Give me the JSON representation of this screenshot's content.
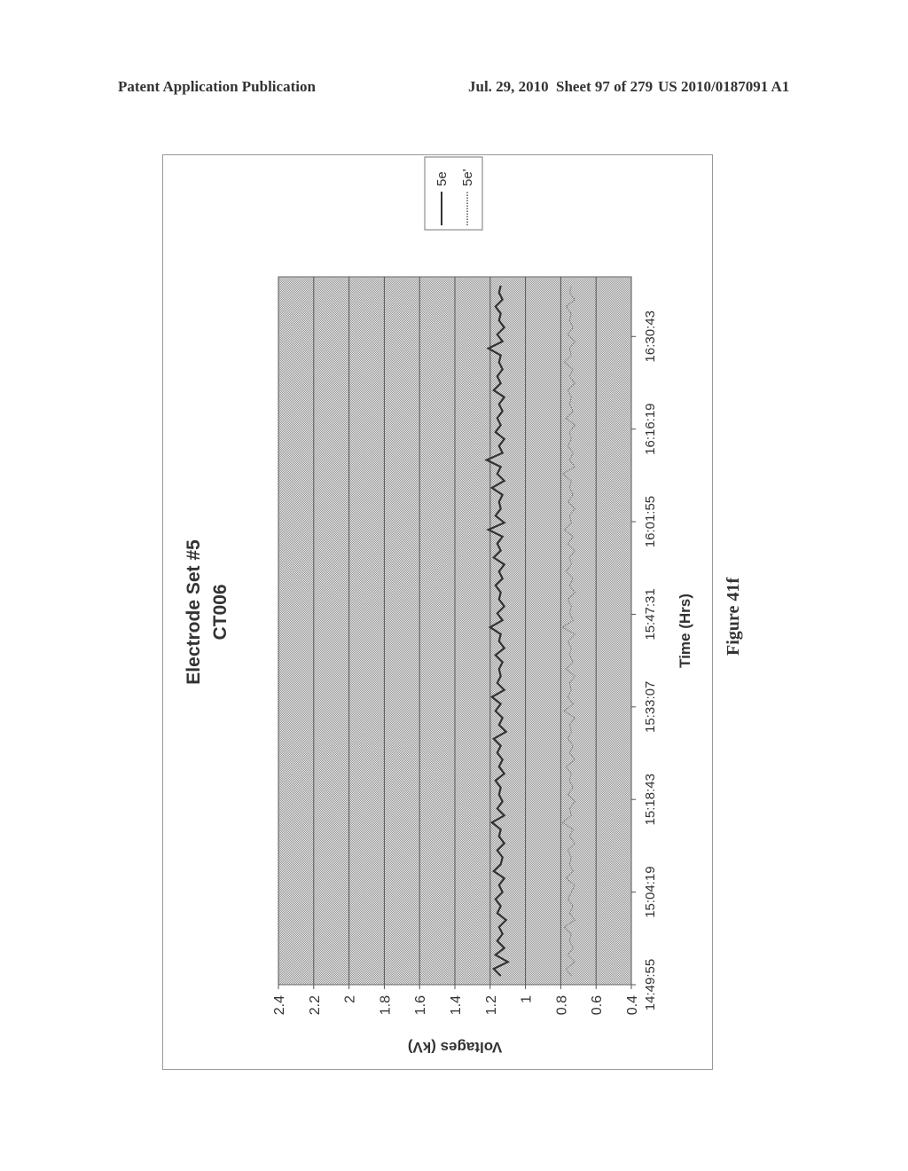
{
  "header": {
    "left": "Patent Application Publication",
    "date": "Jul. 29, 2010",
    "sheet": "Sheet 97 of 279",
    "number": "US 2010/0187091 A1"
  },
  "figure_label": "Figure 41f",
  "chart_data": {
    "type": "line",
    "title": "Electrode Set #5",
    "subtitle": "CT006",
    "xlabel": "Time (Hrs)",
    "ylabel": "Voltages (kV)",
    "orientation": "rotated-90-ccw",
    "ylim": [
      0.4,
      2.4
    ],
    "y_ticks": [
      "2.4",
      "2.2",
      "2",
      "1.8",
      "1.6",
      "1.4",
      "1.2",
      "1",
      "0.8",
      "0.6",
      "0.4"
    ],
    "x_ticks": [
      "14:49:55",
      "15:04:19",
      "15:18:43",
      "15:33:07",
      "15:47:31",
      "16:01:55",
      "16:16:19",
      "16:30:43"
    ],
    "x_range": [
      "14:49:55",
      "16:40:00"
    ],
    "grid": true,
    "legend": {
      "placement": "top-right",
      "entries": [
        "5e",
        "5e'"
      ]
    },
    "series": [
      {
        "name": "5e",
        "style": "solid",
        "values": [
          1.14,
          1.18,
          1.1,
          1.17,
          1.12,
          1.16,
          1.13,
          1.15,
          1.11,
          1.16,
          1.14,
          1.17,
          1.13,
          1.15,
          1.12,
          1.18,
          1.14,
          1.13,
          1.16,
          1.12,
          1.15,
          1.14,
          1.19,
          1.12,
          1.16,
          1.13,
          1.15,
          1.14,
          1.17,
          1.12,
          1.15,
          1.13,
          1.16,
          1.14,
          1.18,
          1.11,
          1.15,
          1.13,
          1.17,
          1.14,
          1.19,
          1.12,
          1.16,
          1.14,
          1.15,
          1.13,
          1.17,
          1.12,
          1.15,
          1.14,
          1.2,
          1.13,
          1.16,
          1.12,
          1.15,
          1.14,
          1.17,
          1.13,
          1.15,
          1.12,
          1.18,
          1.14,
          1.16,
          1.13,
          1.21,
          1.12,
          1.17,
          1.14,
          1.15,
          1.13,
          1.19,
          1.12,
          1.16,
          1.14,
          1.22,
          1.13,
          1.15,
          1.12,
          1.17,
          1.14,
          1.16,
          1.13,
          1.15,
          1.12,
          1.18,
          1.14,
          1.16,
          1.13,
          1.15,
          1.14,
          1.21,
          1.13,
          1.16,
          1.12,
          1.15,
          1.14,
          1.17,
          1.13,
          1.15,
          1.14
        ]
      },
      {
        "name": "5e'",
        "style": "dotted",
        "values": [
          0.74,
          0.77,
          0.72,
          0.76,
          0.73,
          0.75,
          0.74,
          0.78,
          0.72,
          0.75,
          0.73,
          0.76,
          0.74,
          0.72,
          0.77,
          0.73,
          0.75,
          0.74,
          0.76,
          0.72,
          0.75,
          0.73,
          0.79,
          0.74,
          0.75,
          0.72,
          0.76,
          0.73,
          0.75,
          0.74,
          0.77,
          0.72,
          0.75,
          0.73,
          0.76,
          0.74,
          0.75,
          0.72,
          0.78,
          0.73,
          0.76,
          0.74,
          0.75,
          0.72,
          0.77,
          0.73,
          0.75,
          0.74,
          0.76,
          0.72,
          0.79,
          0.73,
          0.75,
          0.74,
          0.76,
          0.72,
          0.75,
          0.73,
          0.77,
          0.74,
          0.75,
          0.72,
          0.76,
          0.73,
          0.78,
          0.74,
          0.75,
          0.72,
          0.76,
          0.73,
          0.75,
          0.74,
          0.79,
          0.72,
          0.75,
          0.73,
          0.76,
          0.74,
          0.75,
          0.72,
          0.77,
          0.73,
          0.75,
          0.74,
          0.76,
          0.72,
          0.75,
          0.73,
          0.78,
          0.74,
          0.75,
          0.72,
          0.76,
          0.73,
          0.75,
          0.74,
          0.77,
          0.72,
          0.75,
          0.74
        ]
      }
    ]
  },
  "colors": {
    "plot_bg": "#c8c8c8",
    "series_5e": "#333333",
    "series_5e_prime": "#777777",
    "grid": "#555555"
  }
}
